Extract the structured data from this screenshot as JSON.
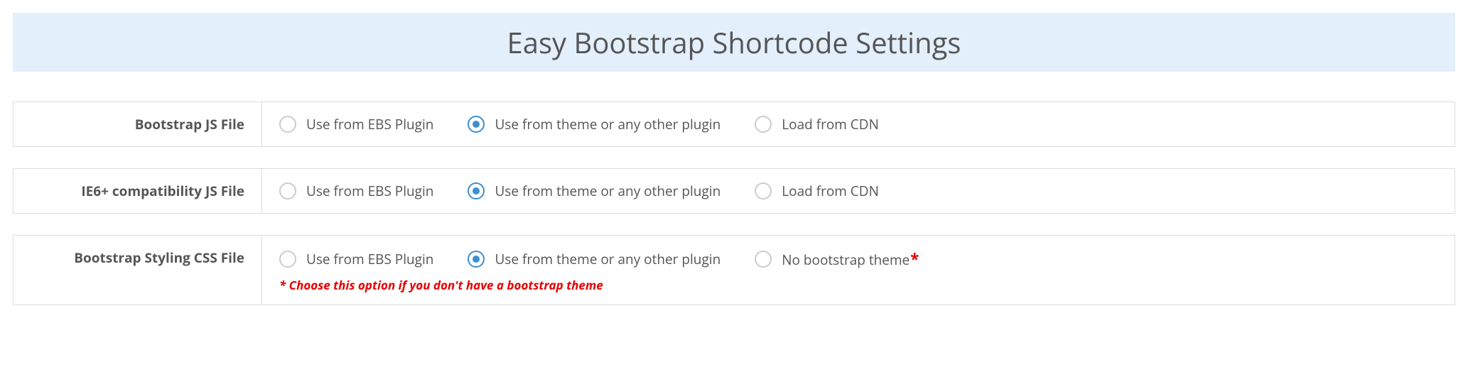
{
  "title": "Easy Bootstrap Shortcode Settings",
  "rows": [
    {
      "label": "Bootstrap JS File",
      "options": [
        {
          "label": "Use from EBS Plugin",
          "selected": false
        },
        {
          "label": "Use from theme or any other plugin",
          "selected": true
        },
        {
          "label": "Load from CDN",
          "selected": false
        }
      ]
    },
    {
      "label": "IE6+ compatibility JS File",
      "options": [
        {
          "label": "Use from EBS Plugin",
          "selected": false
        },
        {
          "label": "Use from theme or any other plugin",
          "selected": true
        },
        {
          "label": "Load from CDN",
          "selected": false
        }
      ]
    },
    {
      "label": "Bootstrap Styling CSS File",
      "options": [
        {
          "label": "Use from EBS Plugin",
          "selected": false
        },
        {
          "label": "Use from theme or any other plugin",
          "selected": true
        },
        {
          "label": "No bootstrap theme",
          "selected": false,
          "asterisk": true
        }
      ],
      "footnote": "* Choose this option if you don't have a bootstrap theme"
    }
  ]
}
